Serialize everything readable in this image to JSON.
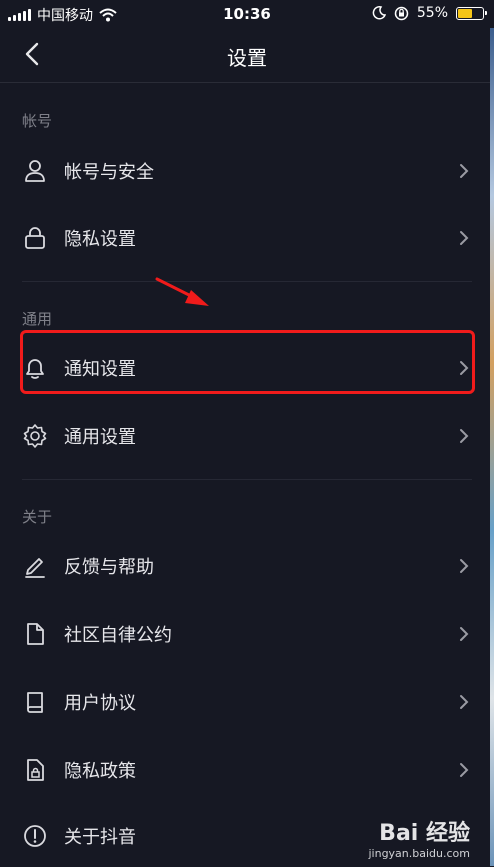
{
  "status": {
    "carrier": "中国移动",
    "time": "10:36",
    "battery": "55%",
    "battery_level": 0.55
  },
  "nav": {
    "title": "设置"
  },
  "sections": [
    {
      "title": "帐号",
      "items": [
        {
          "label": "帐号与安全",
          "icon": "user-icon"
        },
        {
          "label": "隐私设置",
          "icon": "lock-icon"
        }
      ]
    },
    {
      "title": "通用",
      "items": [
        {
          "label": "通知设置",
          "icon": "bell-icon"
        },
        {
          "label": "通用设置",
          "icon": "gear-icon"
        }
      ]
    },
    {
      "title": "关于",
      "items": [
        {
          "label": "反馈与帮助",
          "icon": "pencil-icon"
        },
        {
          "label": "社区自律公约",
          "icon": "document-icon"
        },
        {
          "label": "用户协议",
          "icon": "book-icon"
        },
        {
          "label": "隐私政策",
          "icon": "lock-document-icon"
        },
        {
          "label": "关于抖音",
          "icon": "info-icon"
        }
      ]
    }
  ],
  "watermark": {
    "brand": "Bai 经验",
    "url": "jingyan.baidu.com"
  },
  "colors": {
    "background": "#161823",
    "highlight": "#f01b1b"
  }
}
